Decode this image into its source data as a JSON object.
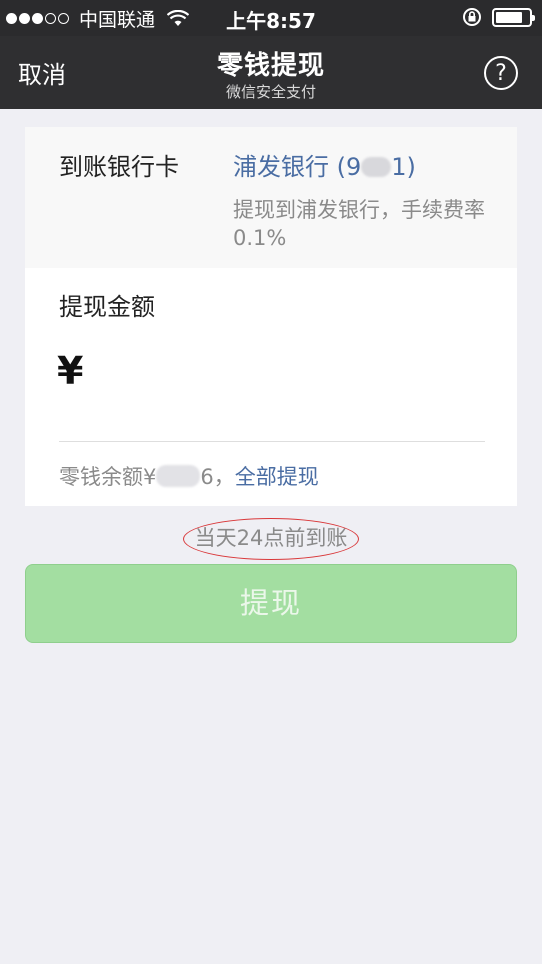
{
  "status_bar": {
    "carrier": "中国联通",
    "time": "上午8:57",
    "signal_icon": "signal-dots-icon",
    "wifi_icon": "wifi-icon",
    "lock_icon": "rotation-lock-icon",
    "battery_icon": "battery-icon"
  },
  "nav": {
    "cancel_label": "取消",
    "title": "零钱提现",
    "subtitle": "微信安全支付",
    "help_label": "?"
  },
  "bank": {
    "label": "到账银行卡",
    "name_prefix": "浦发银行 (9",
    "name_suffix": "1)",
    "note": "提现到浦发银行，手续费率0.1%"
  },
  "amount": {
    "label": "提现金额",
    "currency": "¥",
    "value": ""
  },
  "balance": {
    "prefix": "零钱余额¥",
    "suffix": "6，",
    "withdraw_all_label": "全部提现"
  },
  "arrival_note": "当天24点前到账",
  "withdraw_button_label": "提现",
  "colors": {
    "nav_bg": "#2f2f31",
    "link": "#4a6da3",
    "button_disabled": "#a3dea1",
    "annotation_circle": "#d9383a"
  }
}
